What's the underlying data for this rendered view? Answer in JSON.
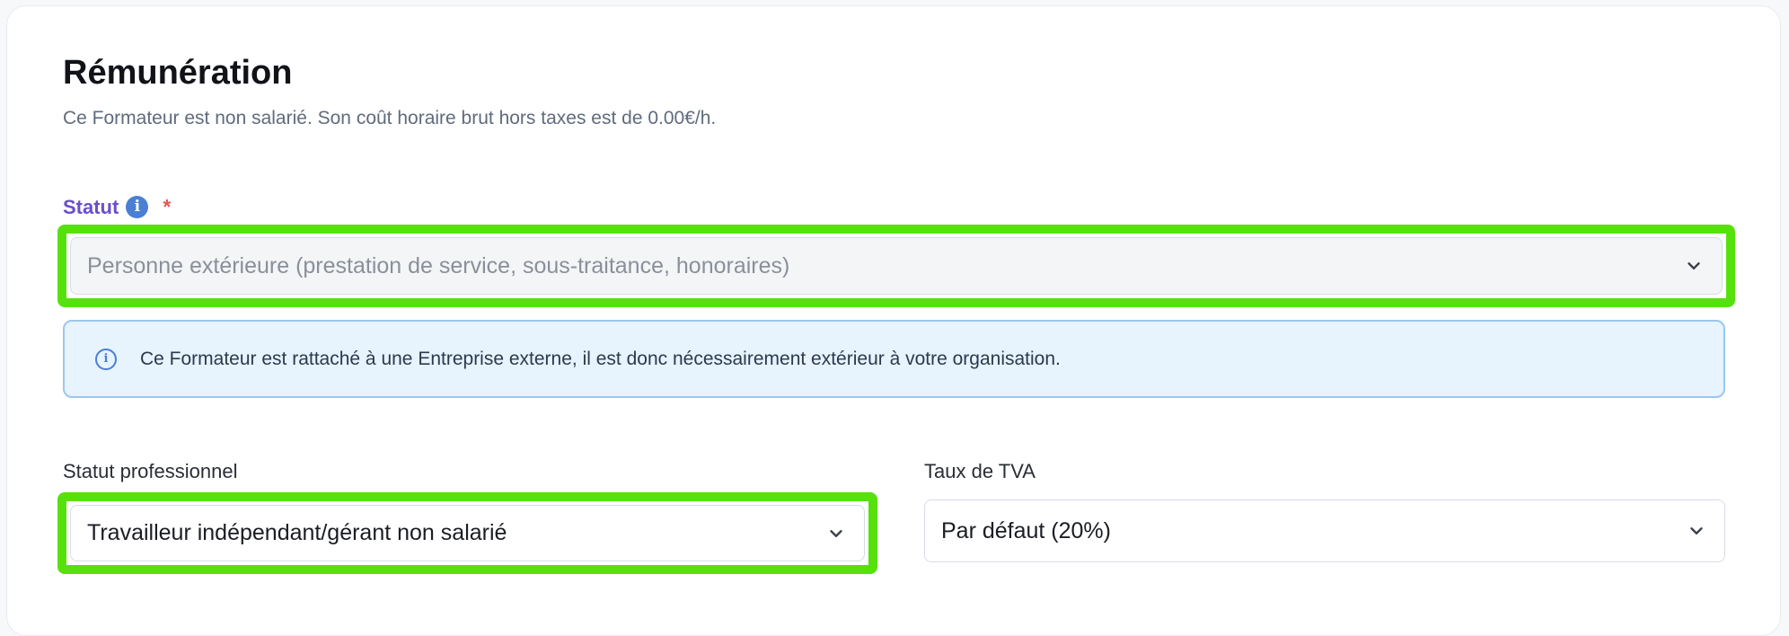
{
  "section": {
    "title": "Rémunération",
    "description": "Ce Formateur est non salarié. Son coût horaire brut hors taxes est de 0.00€/h."
  },
  "statut": {
    "label": "Statut",
    "required_mark": "*",
    "info_icon": "info-circle-icon",
    "value": "Personne extérieure (prestation de service, sous-traitance, honoraires)",
    "disabled": true
  },
  "alert": {
    "icon": "info-outline-icon",
    "message": "Ce Formateur est rattaché à une Entreprise externe, il est donc nécessairement extérieur à votre organisation."
  },
  "statut_professionnel": {
    "label": "Statut professionnel",
    "value": "Travailleur indépendant/gérant non salarié"
  },
  "taux_tva": {
    "label": "Taux de TVA",
    "value": "Par défaut (20%)"
  },
  "colors": {
    "highlight": "#56e10d",
    "label_accent": "#6a4fc9",
    "required": "#e45757",
    "info": "#4a7fd3",
    "alert_bg": "#e7f3fd",
    "alert_border": "#9cc6ee"
  }
}
